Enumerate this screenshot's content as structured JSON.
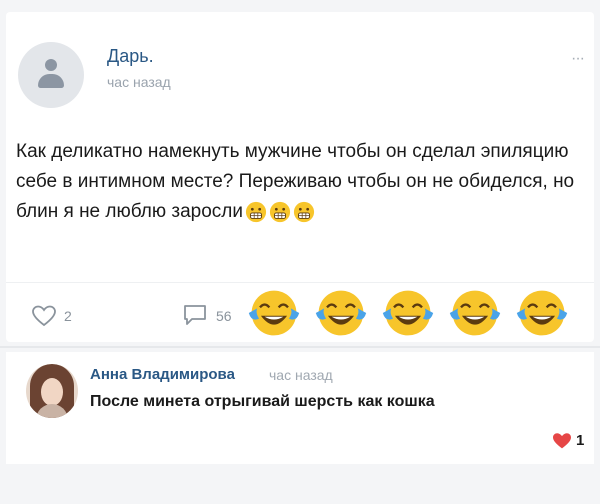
{
  "post": {
    "author": "Дарь.",
    "time": "час назад",
    "more_glyph": "···",
    "text": "Как деликатно намекнуть мужчине чтобы он сделал эпиляцию себе в интимном месте? Переживаю чтобы он не обиделся, но блин я не люблю заросли",
    "inline_emojis": [
      "grimacing-face-emoji",
      "grimacing-face-emoji",
      "grimacing-face-emoji"
    ],
    "likes": "2",
    "comments": "56",
    "reaction_emojis": [
      "face-with-tears-of-joy",
      "face-with-tears-of-joy",
      "face-with-tears-of-joy",
      "face-with-tears-of-joy",
      "face-with-tears-of-joy"
    ]
  },
  "comment": {
    "author": "Анна Владимирова",
    "time": "час назад",
    "text": "После минета отрыгивай шерсть как кошка",
    "likes": "1"
  },
  "colors": {
    "link": "#2a5885",
    "muted": "#9aa3ad",
    "like_red": "#e64646",
    "emoji_yellow": "#f7c52b"
  }
}
